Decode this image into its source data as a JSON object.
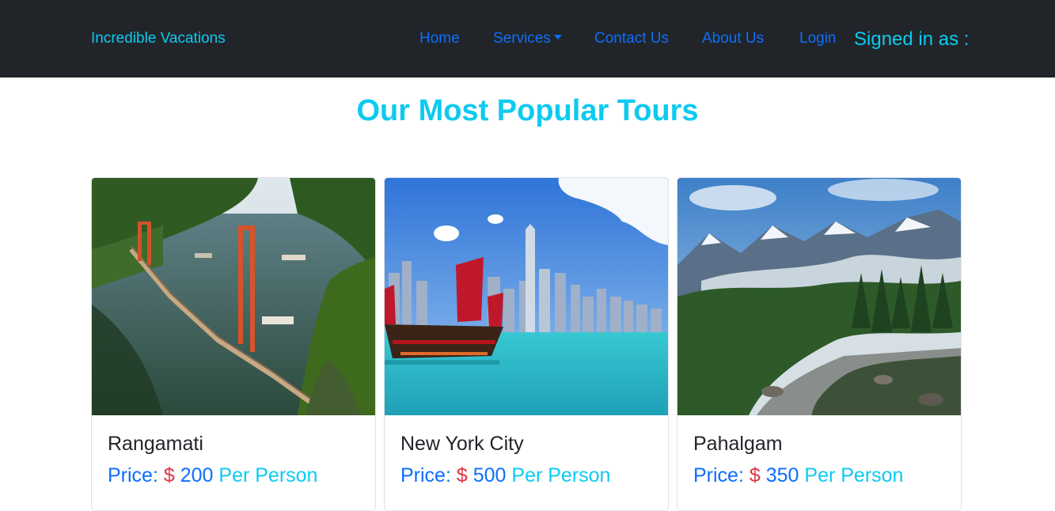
{
  "navbar": {
    "brand": "Incredible Vacations",
    "links": [
      "Home",
      "Services",
      "Contact Us",
      "About Us",
      "Login"
    ],
    "signed_in": "Signed in as :"
  },
  "page": {
    "title": "Our Most Popular Tours"
  },
  "tours": [
    {
      "name": "Rangamati",
      "price_label": "Price:",
      "currency": "$",
      "amount": "200",
      "per": "Per Person"
    },
    {
      "name": "New York City",
      "price_label": "Price:",
      "currency": "$",
      "amount": "500",
      "per": "Per Person"
    },
    {
      "name": "Pahalgam",
      "price_label": "Price:",
      "currency": "$",
      "amount": "350",
      "per": "Per Person"
    }
  ],
  "colors": {
    "navbar_bg": "#212529",
    "brand": "#0dcaf0",
    "link": "#0d6efd",
    "currency": "#dc3545",
    "title": "#0dcaf0"
  }
}
